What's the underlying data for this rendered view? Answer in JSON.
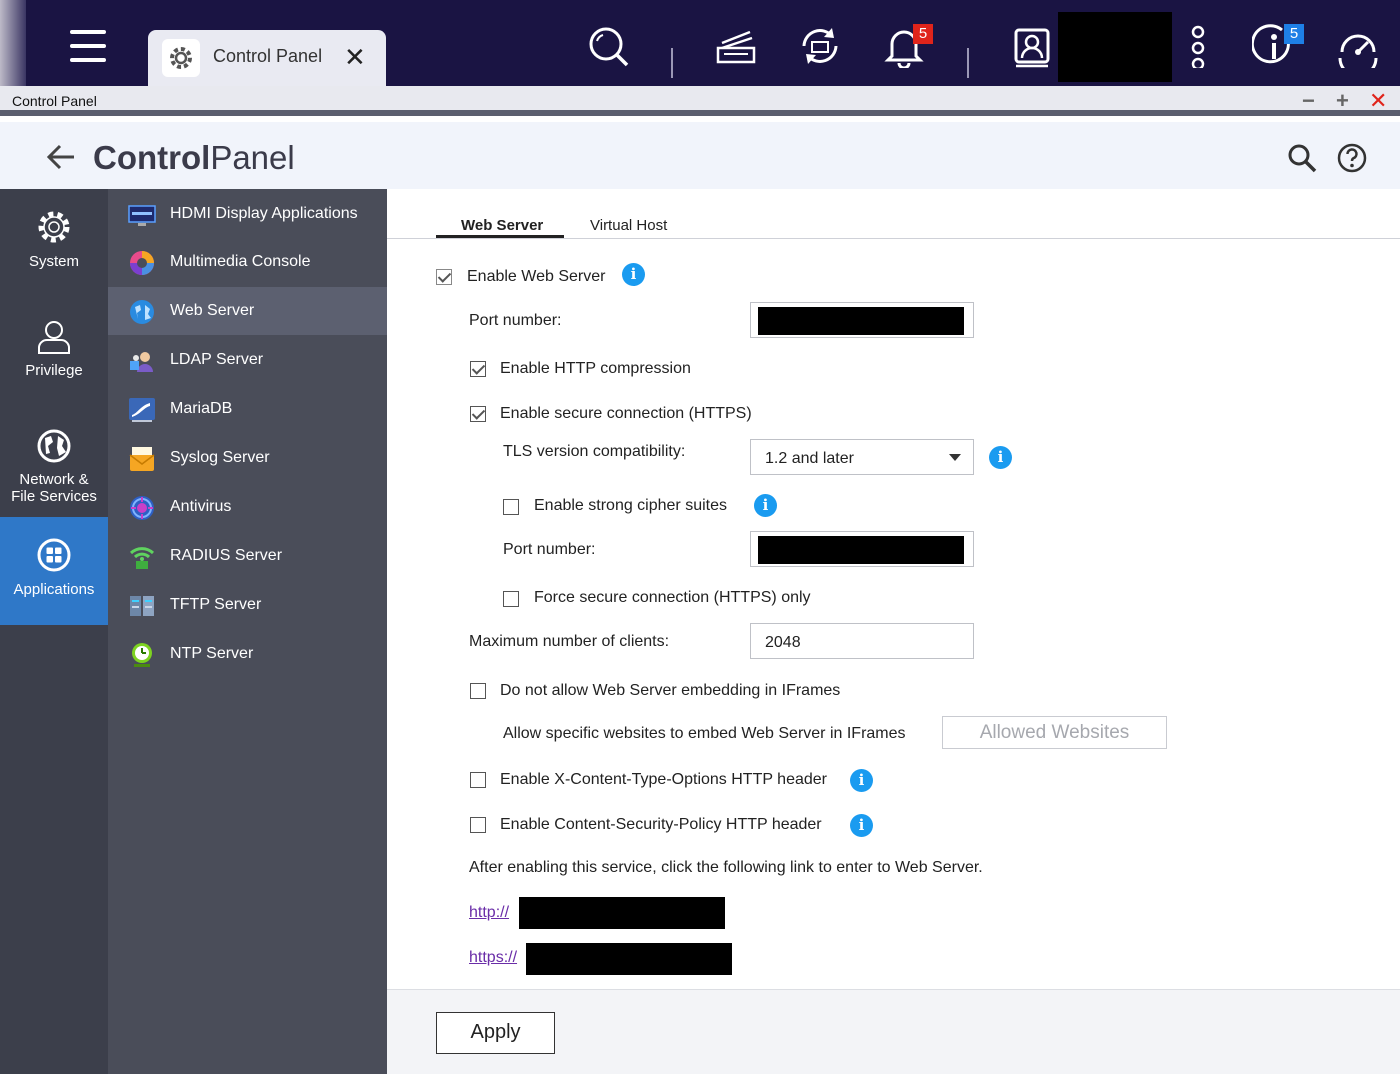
{
  "taskbar": {
    "app_tab_title": "Control Panel",
    "notification_count": "5",
    "info_count": "5",
    "icons": [
      "search-icon",
      "tasks-icon",
      "sync-icon",
      "bell-icon",
      "user-icon",
      "more-icon",
      "info-icon",
      "dashboard-icon"
    ]
  },
  "window": {
    "title": "Control Panel",
    "minimize": "−",
    "maximize": "+",
    "close": "✕"
  },
  "header": {
    "title_bold": "Control",
    "title_rest": "Panel"
  },
  "categories": [
    {
      "label": "System",
      "icon": "gear-icon"
    },
    {
      "label": "Privilege",
      "icon": "user-icon"
    },
    {
      "label_line1": "Network &",
      "label_line2": "File Services",
      "icon": "globe-icon"
    },
    {
      "label": "Applications",
      "icon": "apps-icon",
      "active": true
    }
  ],
  "sub_menu": [
    {
      "label": "HDMI Display Applications",
      "icon": "hdmi-icon"
    },
    {
      "label": "Multimedia Console",
      "icon": "multimedia-icon"
    },
    {
      "label": "Web Server",
      "icon": "web-server-icon",
      "active": true
    },
    {
      "label": "LDAP Server",
      "icon": "ldap-icon"
    },
    {
      "label": "MariaDB",
      "icon": "mariadb-icon"
    },
    {
      "label": "Syslog Server",
      "icon": "syslog-icon"
    },
    {
      "label": "Antivirus",
      "icon": "antivirus-icon"
    },
    {
      "label": "RADIUS Server",
      "icon": "radius-icon"
    },
    {
      "label": "TFTP Server",
      "icon": "tftp-icon"
    },
    {
      "label": "NTP Server",
      "icon": "ntp-icon"
    }
  ],
  "tabs": [
    {
      "label": "Web Server",
      "active": true
    },
    {
      "label": "Virtual Host",
      "active": false
    }
  ],
  "form": {
    "enable_web_server": "Enable Web Server",
    "port_number": "Port number:",
    "enable_http_compression": "Enable HTTP compression",
    "enable_https": "Enable secure connection (HTTPS)",
    "tls_label": "TLS version compatibility:",
    "tls_value": "1.2 and later",
    "strong_cipher": "Enable strong cipher suites",
    "https_port_number": "Port number:",
    "force_https": "Force secure connection (HTTPS) only",
    "max_clients_label": "Maximum number of clients:",
    "max_clients_value": "2048",
    "no_iframe": "Do not allow Web Server embedding in IFrames",
    "allow_iframe_label": "Allow specific websites to embed Web Server in IFrames",
    "allowed_websites_btn": "Allowed Websites",
    "x_content_type": "Enable X-Content-Type-Options HTTP header",
    "csp": "Enable Content-Security-Policy HTTP header",
    "after_enable_note": "After enabling this service, click the following link to enter to Web Server.",
    "http_link": "http://",
    "https_link": "https://"
  },
  "footer": {
    "apply": "Apply"
  }
}
